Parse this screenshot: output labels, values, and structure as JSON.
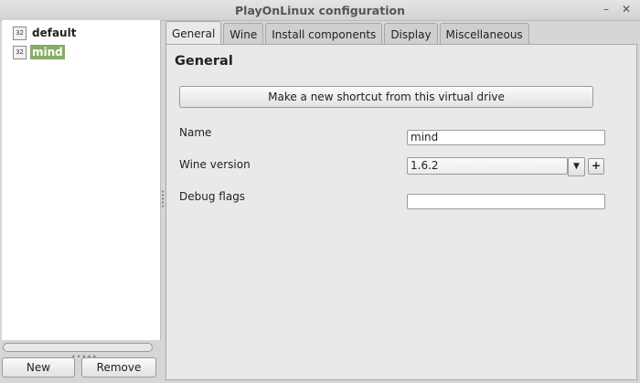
{
  "window": {
    "title": "PlayOnLinux configuration",
    "minimize_glyph": "–",
    "close_glyph": "✕"
  },
  "sidebar": {
    "items": [
      {
        "badge": "32",
        "label": "default",
        "selected": false
      },
      {
        "badge": "32",
        "label": "mind",
        "selected": true
      }
    ],
    "new_label": "New",
    "remove_label": "Remove"
  },
  "tabs": [
    {
      "label": "General",
      "active": true
    },
    {
      "label": "Wine",
      "active": false
    },
    {
      "label": "Install components",
      "active": false
    },
    {
      "label": "Display",
      "active": false
    },
    {
      "label": "Miscellaneous",
      "active": false
    }
  ],
  "general": {
    "heading": "General",
    "shortcut_button": "Make a new shortcut from this virtual drive",
    "name_label": "Name",
    "name_value": "mind",
    "wine_version_label": "Wine version",
    "wine_version_value": "1.6.2",
    "debug_flags_label": "Debug flags",
    "debug_flags_value": ""
  },
  "colors": {
    "selection": "#8aab66"
  },
  "icons": {
    "wine_dropdown": "chevron-down-icon",
    "wine_add": "plus-icon"
  }
}
